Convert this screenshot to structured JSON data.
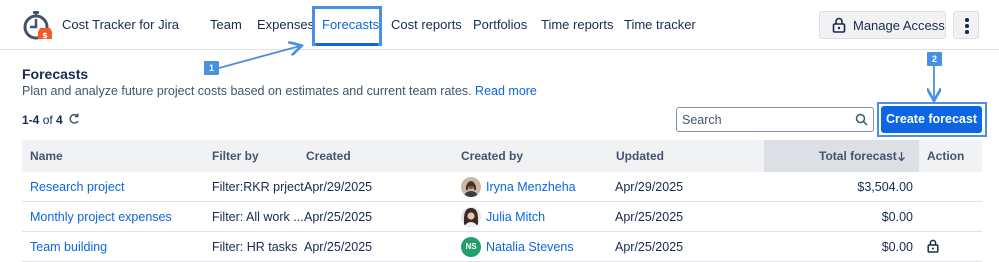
{
  "app": {
    "title": "Cost Tracker for Jira"
  },
  "nav": {
    "items": [
      {
        "label": "Team"
      },
      {
        "label": "Expenses"
      },
      {
        "label": "Forecasts"
      },
      {
        "label": "Cost reports"
      },
      {
        "label": "Portfolios"
      },
      {
        "label": "Time reports"
      },
      {
        "label": "Time tracker"
      }
    ],
    "active": "Forecasts",
    "manage_access": "Manage Access"
  },
  "callouts": {
    "one": "1",
    "two": "2"
  },
  "page": {
    "title": "Forecasts",
    "description": "Plan and analyze future project costs based on estimates and current team rates.",
    "read_more": "Read more",
    "count_range": "1-4",
    "count_of": "of",
    "count_total": "4"
  },
  "search": {
    "placeholder": "Search"
  },
  "create_button": "Create forecast",
  "table": {
    "columns": {
      "name": "Name",
      "filter": "Filter by",
      "created": "Created",
      "created_by": "Created by",
      "updated": "Updated",
      "total": "Total forecast",
      "action": "Action"
    },
    "rows": [
      {
        "name": "Research project",
        "filter": "Filter:RKR prject",
        "created": "Apr/29/2025",
        "created_by": "Iryna Menzheha",
        "updated": "Apr/29/2025",
        "total": "$3,504.00"
      },
      {
        "name": "Monthly project expenses",
        "filter": "Filter: All work ...",
        "created": "Apr/25/2025",
        "created_by": "Julia Mitch",
        "updated": "Apr/25/2025",
        "total": "$0.00"
      },
      {
        "name": "Team building",
        "filter": "Filter: HR tasks",
        "created": "Apr/25/2025",
        "created_by": "Natalia Stevens",
        "created_by_initials": "NS",
        "updated": "Apr/25/2025",
        "total": "$0.00"
      }
    ]
  },
  "colors": {
    "accent": "#0c66e4",
    "callout": "#4a90e2",
    "initials_avatar": "#22a06b"
  },
  "icons": [
    "stopwatch-money-logo-icon",
    "lock-icon",
    "more-vertical-icon",
    "refresh-icon",
    "search-icon",
    "sort-down-arrow-icon"
  ]
}
